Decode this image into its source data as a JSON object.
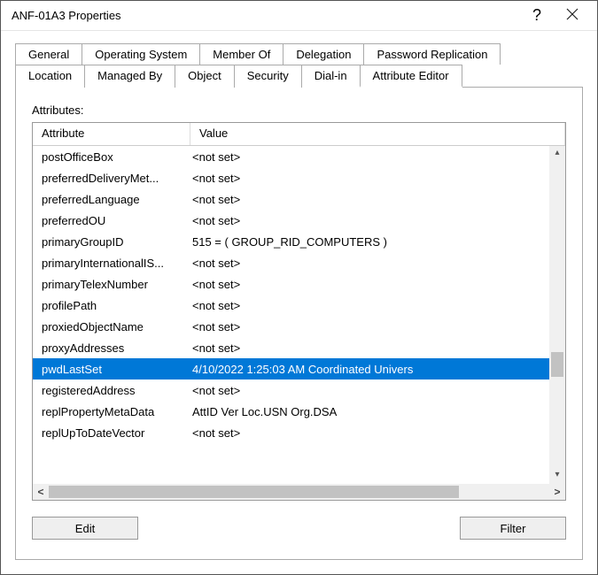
{
  "window": {
    "title": "ANF-01A3 Properties"
  },
  "tabs_row1": [
    {
      "label": "General"
    },
    {
      "label": "Operating System"
    },
    {
      "label": "Member Of"
    },
    {
      "label": "Delegation"
    },
    {
      "label": "Password Replication"
    }
  ],
  "tabs_row2": [
    {
      "label": "Location"
    },
    {
      "label": "Managed By"
    },
    {
      "label": "Object"
    },
    {
      "label": "Security"
    },
    {
      "label": "Dial-in"
    },
    {
      "label": "Attribute Editor",
      "active": true
    }
  ],
  "panel": {
    "attributes_label": "Attributes:",
    "header_attr": "Attribute",
    "header_val": "Value",
    "edit_label": "Edit",
    "filter_label": "Filter"
  },
  "rows": [
    {
      "attr": "postOfficeBox",
      "val": "<not set>"
    },
    {
      "attr": "preferredDeliveryMet...",
      "val": "<not set>"
    },
    {
      "attr": "preferredLanguage",
      "val": "<not set>"
    },
    {
      "attr": "preferredOU",
      "val": "<not set>"
    },
    {
      "attr": "primaryGroupID",
      "val": "515 = ( GROUP_RID_COMPUTERS )"
    },
    {
      "attr": "primaryInternationalIS...",
      "val": "<not set>"
    },
    {
      "attr": "primaryTelexNumber",
      "val": "<not set>"
    },
    {
      "attr": "profilePath",
      "val": "<not set>"
    },
    {
      "attr": "proxiedObjectName",
      "val": "<not set>"
    },
    {
      "attr": "proxyAddresses",
      "val": "<not set>"
    },
    {
      "attr": "pwdLastSet",
      "val": "4/10/2022 1:25:03 AM Coordinated Univers",
      "selected": true
    },
    {
      "attr": "registeredAddress",
      "val": "<not set>"
    },
    {
      "attr": "replPropertyMetaData",
      "val": " AttID  Ver      Loc.USN                    Org.DSA"
    },
    {
      "attr": "replUpToDateVector",
      "val": "<not set>"
    }
  ]
}
